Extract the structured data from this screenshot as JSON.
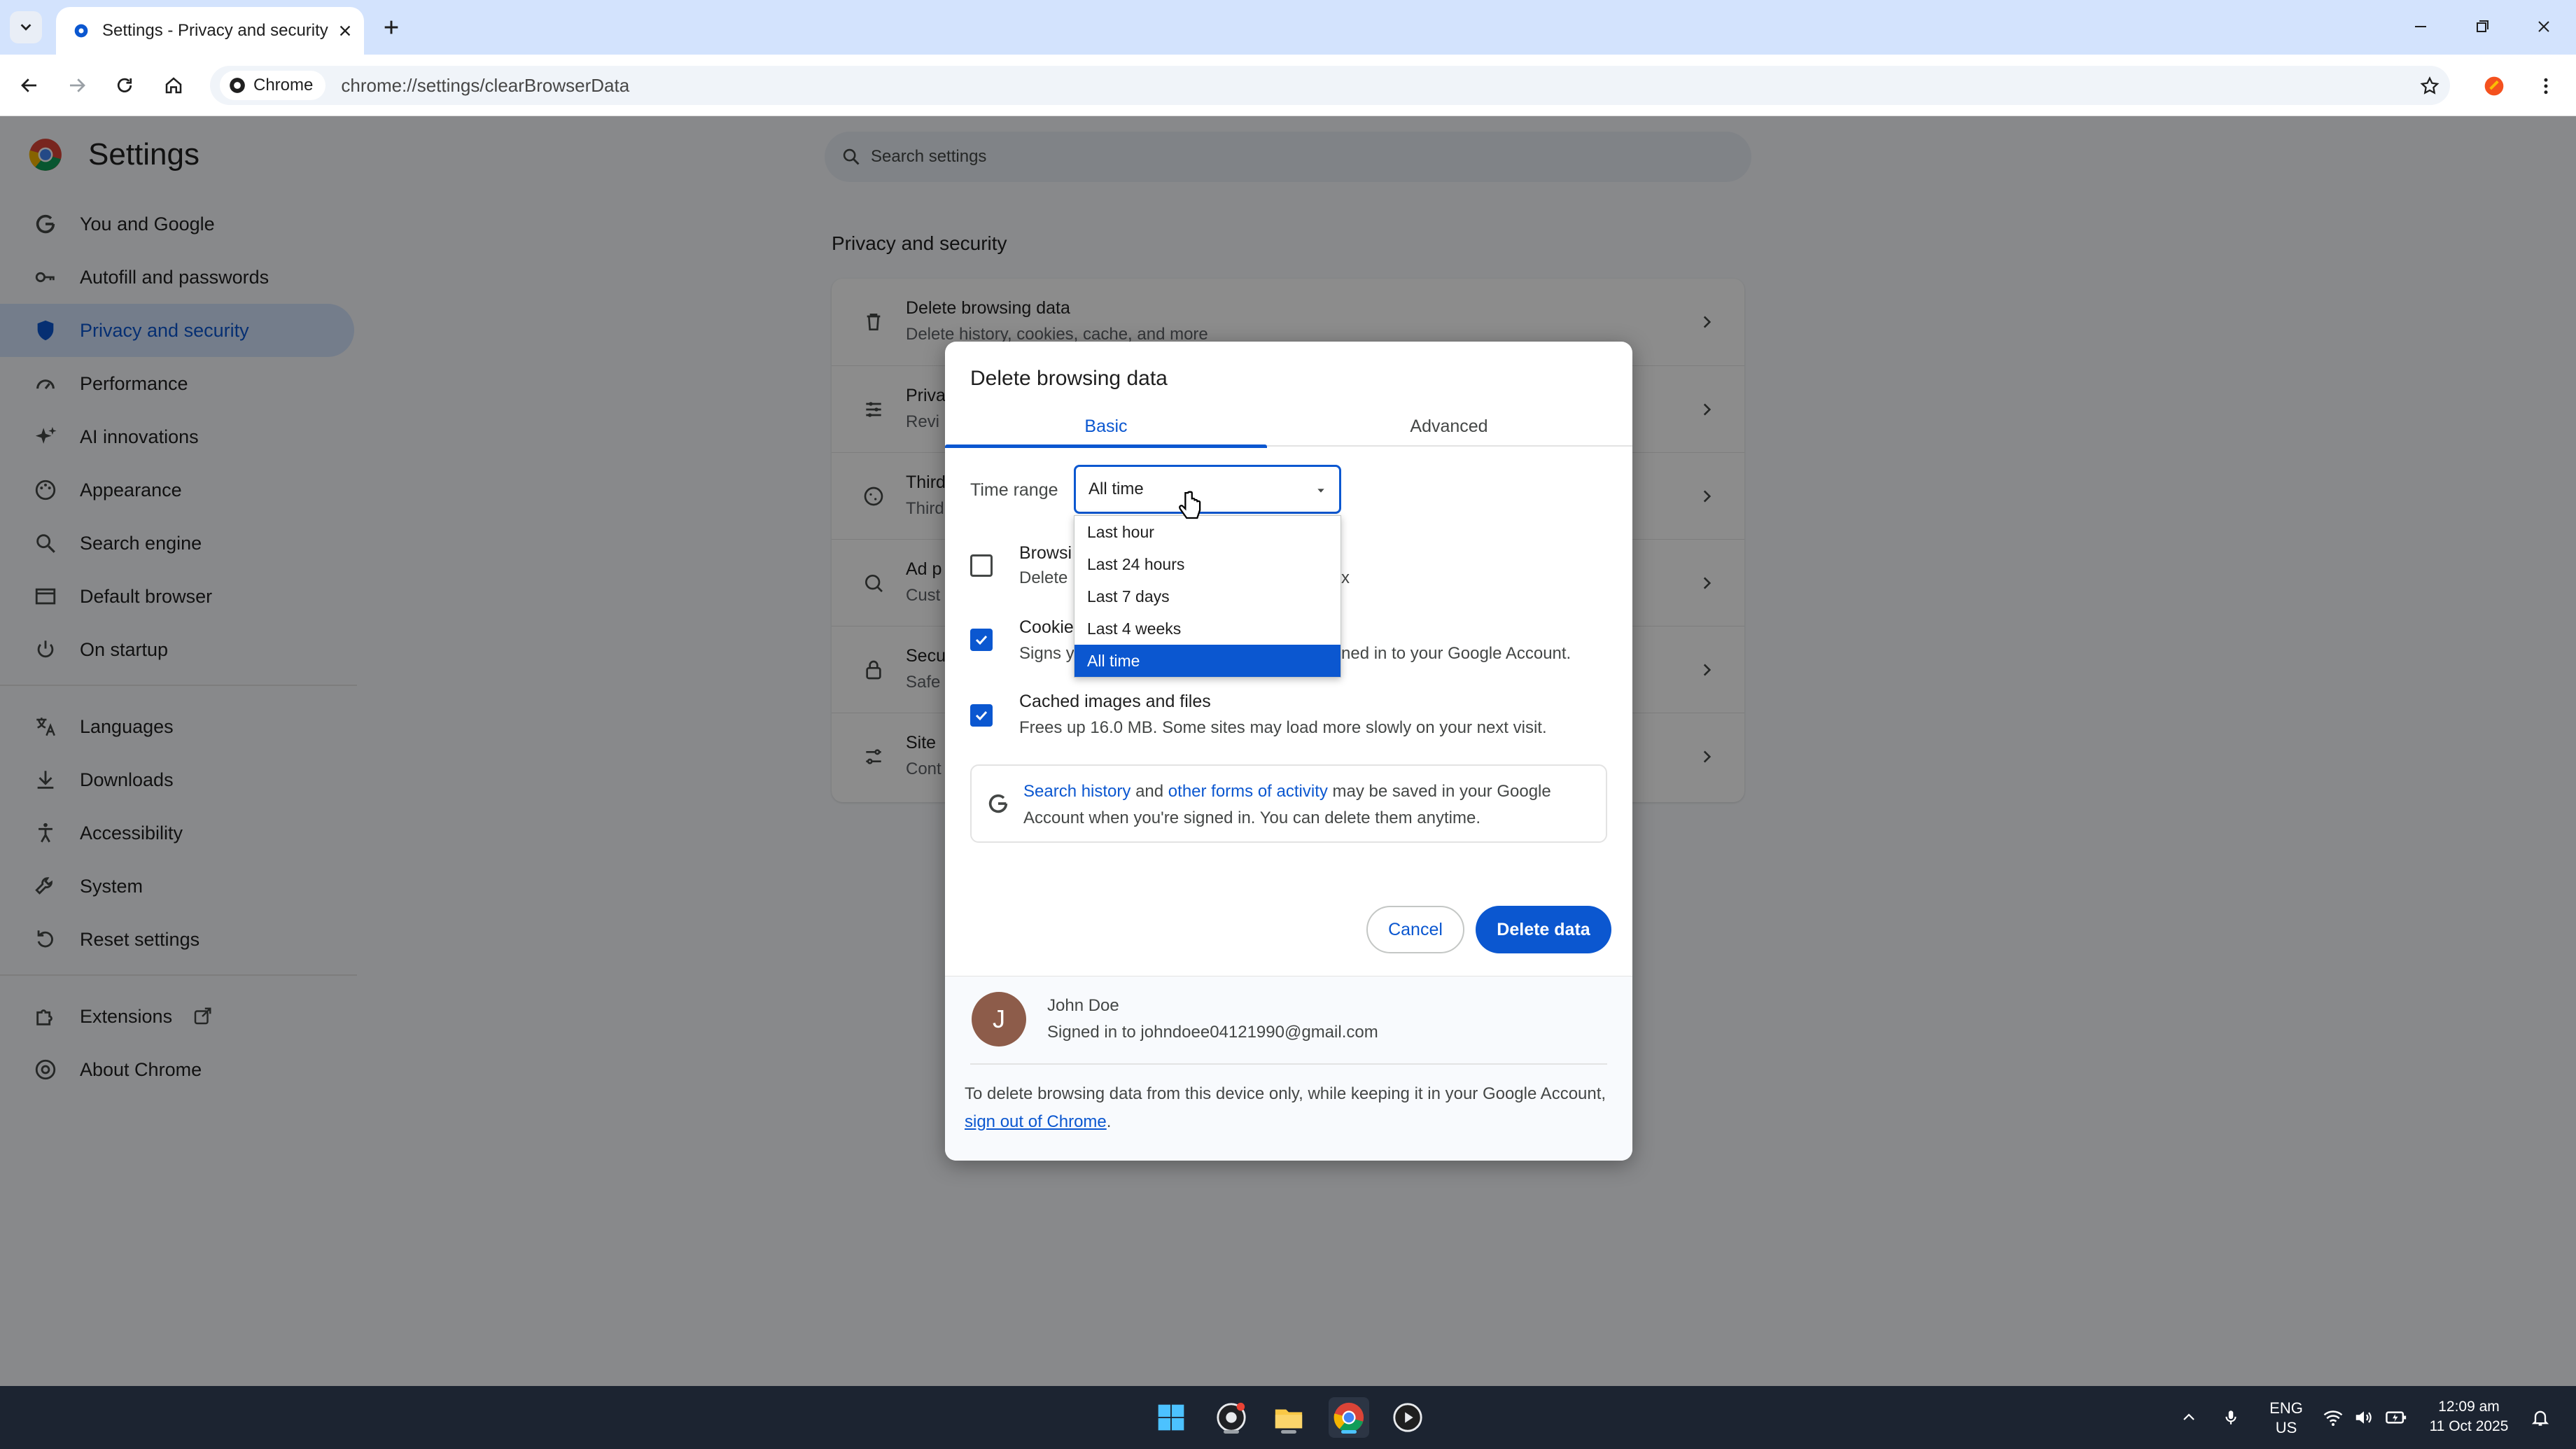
{
  "browser": {
    "tab_title": "Settings - Privacy and security",
    "chip_label": "Chrome",
    "url": "chrome://settings/clearBrowserData"
  },
  "settings": {
    "title": "Settings",
    "search_placeholder": "Search settings",
    "sidebar": [
      {
        "label": "You and Google",
        "icon": "google-g-icon"
      },
      {
        "label": "Autofill and passwords",
        "icon": "key-icon"
      },
      {
        "label": "Privacy and security",
        "icon": "shield-icon",
        "active": true
      },
      {
        "label": "Performance",
        "icon": "speedometer-icon"
      },
      {
        "label": "AI innovations",
        "icon": "sparkle-icon"
      },
      {
        "label": "Appearance",
        "icon": "palette-icon"
      },
      {
        "label": "Search engine",
        "icon": "search-icon"
      },
      {
        "label": "Default browser",
        "icon": "browser-window-icon"
      },
      {
        "label": "On startup",
        "icon": "power-icon"
      },
      {
        "label": "Languages",
        "icon": "translate-icon"
      },
      {
        "label": "Downloads",
        "icon": "download-icon"
      },
      {
        "label": "Accessibility",
        "icon": "accessibility-icon"
      },
      {
        "label": "System",
        "icon": "wrench-icon"
      },
      {
        "label": "Reset settings",
        "icon": "reset-icon"
      },
      {
        "label": "Extensions",
        "icon": "puzzle-icon"
      },
      {
        "label": "About Chrome",
        "icon": "chrome-icon"
      }
    ],
    "section_title": "Privacy and security",
    "rows": [
      {
        "title": "Delete browsing data",
        "subtitle": "Delete history, cookies, cache, and more",
        "icon": "trash-icon"
      },
      {
        "title": "Priva",
        "subtitle": "Revi",
        "icon": "sliders-icon"
      },
      {
        "title": "Third",
        "subtitle": "Third",
        "icon": "cookie-icon"
      },
      {
        "title": "Ad p",
        "subtitle": "Cust",
        "icon": "ad-privacy-icon"
      },
      {
        "title": "Secu",
        "subtitle": "Safe",
        "icon": "lock-icon"
      },
      {
        "title": "Site",
        "subtitle": "Cont",
        "icon": "site-settings-icon"
      }
    ]
  },
  "dialog": {
    "title": "Delete browsing data",
    "tabs": [
      "Basic",
      "Advanced"
    ],
    "active_tab": "Basic",
    "time_range_label": "Time range",
    "time_range_value": "All time",
    "time_range_options": [
      "Last hour",
      "Last 24 hours",
      "Last 7 days",
      "Last 4 weeks",
      "All time"
    ],
    "options": [
      {
        "title": "Browsi",
        "subtitle": "Delete",
        "checked": false,
        "tail": "x"
      },
      {
        "title": "Cookie",
        "subtitle": "Signs y",
        "checked": true,
        "tail": "ned in to your Google Account."
      },
      {
        "title": "Cached images and files",
        "subtitle": "Frees up 16.0 MB. Some sites may load more slowly on your next visit.",
        "checked": true
      }
    ],
    "info": {
      "link1": "Search history",
      "and": " and ",
      "link2": "other forms of activity",
      "rest": " may be saved in your Google Account when you're signed in. You can delete them anytime."
    },
    "cancel": "Cancel",
    "delete": "Delete data",
    "account": {
      "initial": "J",
      "name": "John Doe",
      "email": "Signed in to johndoee04121990@gmail.com"
    },
    "footer_text": "To delete browsing data from this device only, while keeping it in your Google Account, ",
    "footer_link": "sign out of Chrome",
    "footer_end": "."
  },
  "taskbar": {
    "lang": "ENG",
    "region": "US",
    "time": "12:09 am",
    "date": "11 Oct 2025"
  },
  "colors": {
    "accent": "#0b57d0",
    "taskbar": "#1c2431",
    "tabstrip": "#d3e3fd"
  }
}
